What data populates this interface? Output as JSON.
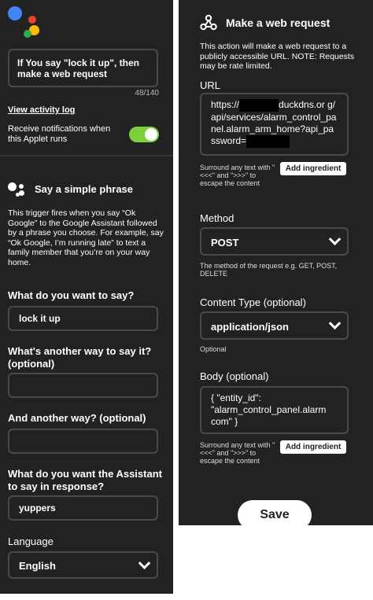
{
  "left": {
    "trigger_title": "If You say \"lock it up\", then make a web request",
    "char_count": "48/140",
    "activity_log_link": "View activity log",
    "notify_label": "Receive notifications when this Applet runs",
    "notify_enabled": true,
    "section_title": "Say a simple phrase",
    "description": "This trigger fires when you say “Ok Google” to the Google Assistant followed by a phrase you choose. For example, say “Ok Google, I’m running late” to text a family member that you’re on your way home.",
    "fields": [
      {
        "label": "What do you want to say?",
        "value": "lock it up"
      },
      {
        "label": "What's another way to say it? (optional)",
        "value": ""
      },
      {
        "label": "And another way? (optional)",
        "value": ""
      },
      {
        "label": "What do you want the Assistant to say in response?",
        "value": "yuppers"
      }
    ],
    "language_label": "Language",
    "language_value": "English"
  },
  "right": {
    "title": "Make a web request",
    "description": "This action will make a web request to a publicly accessible URL. NOTE: Requests may be rate limited.",
    "url_label": "URL",
    "url_part1": "https://",
    "url_part2": "duckdns.or g/api/services/alarm_control_panel.alarm_arm_home?api_password=",
    "url_hint": "Surround any text with \"<<<\" and \">>>\" to escape the content",
    "add_ingredient": "Add ingredient",
    "method_label": "Method",
    "method_value": "POST",
    "method_hint": "The method of the request e.g. GET, POST, DELETE",
    "content_type_label": "Content Type (optional)",
    "content_type_value": "application/json",
    "content_type_hint": "Optional",
    "body_label": "Body (optional)",
    "body_value": "{ \"entity_id\": \"alarm_control_panel.alarm com\" }",
    "body_hint": "Surround any text with \"<<<\" and \">>>\" to escape the content",
    "save_label": "Save"
  },
  "colors": {
    "panel_bg": "#222222",
    "toggle_on": "#7cd03b",
    "field_border": "#4a4a4a",
    "google_blue": "#4285f4",
    "google_red": "#ea4335",
    "google_yellow": "#fbbc05",
    "google_green": "#34a853"
  }
}
